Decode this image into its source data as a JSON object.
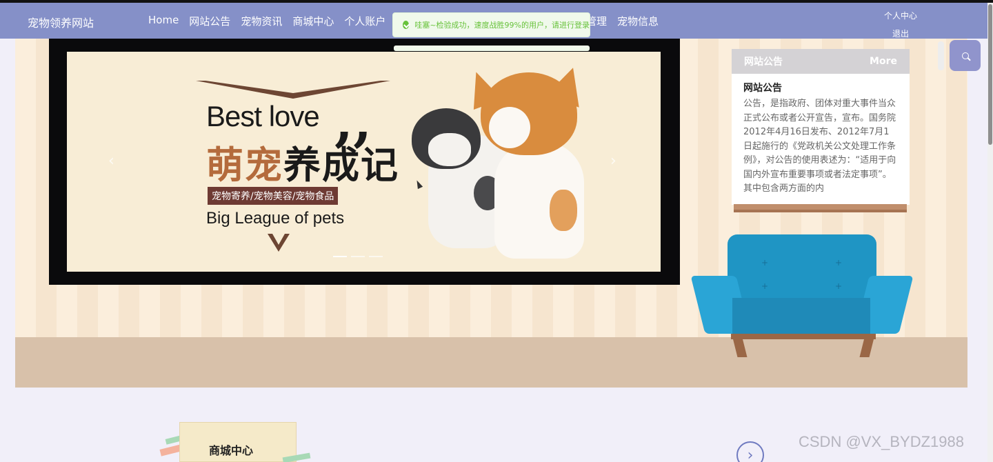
{
  "header": {
    "brand": "宠物领养网站",
    "nav": [
      "Home",
      "网站公告",
      "宠物资讯",
      "商城中心",
      "个人账户"
    ],
    "nav_hidden_tail": [
      "管理",
      "宠物信息"
    ],
    "user_links": [
      "个人中心",
      "退出"
    ]
  },
  "toast": {
    "message": "哇塞~检验成功，速度战胜99%的用户，请进行登录",
    "icon": "check-circle-icon"
  },
  "banner": {
    "headline_en": "Best love",
    "quote": "❞",
    "headline_cn_a": "萌宠",
    "headline_cn_b": "养成记",
    "tagline": "宠物寄养/宠物美容/宠物食品",
    "subtitle": "Big League of pets",
    "prev_arrow": "‹",
    "next_arrow": "›",
    "slide_count": 3,
    "active_slide": 1
  },
  "notice": {
    "header": "网站公告",
    "more": "More",
    "title": "网站公告",
    "body": "公告，是指政府、团体对重大事件当众正式公布或者公开宣告，宣布。国务院2012年4月16日发布、2012年7月1日起施行的《党政机关公文处理工作条例》，对公告的使用表述为：“适用于向国内外宣布重要事项或者法定事项”。其中包含两方面的内"
  },
  "sections": {
    "mall_title": "商城中心",
    "next_icon": "›"
  },
  "watermark": "CSDN @VX_BYDZ1988",
  "colors": {
    "nav_bg": "#8590c8",
    "accent": "#9094cc",
    "success": "#67c23a",
    "brown": "#6d4633",
    "sofa": "#1f95c4"
  }
}
